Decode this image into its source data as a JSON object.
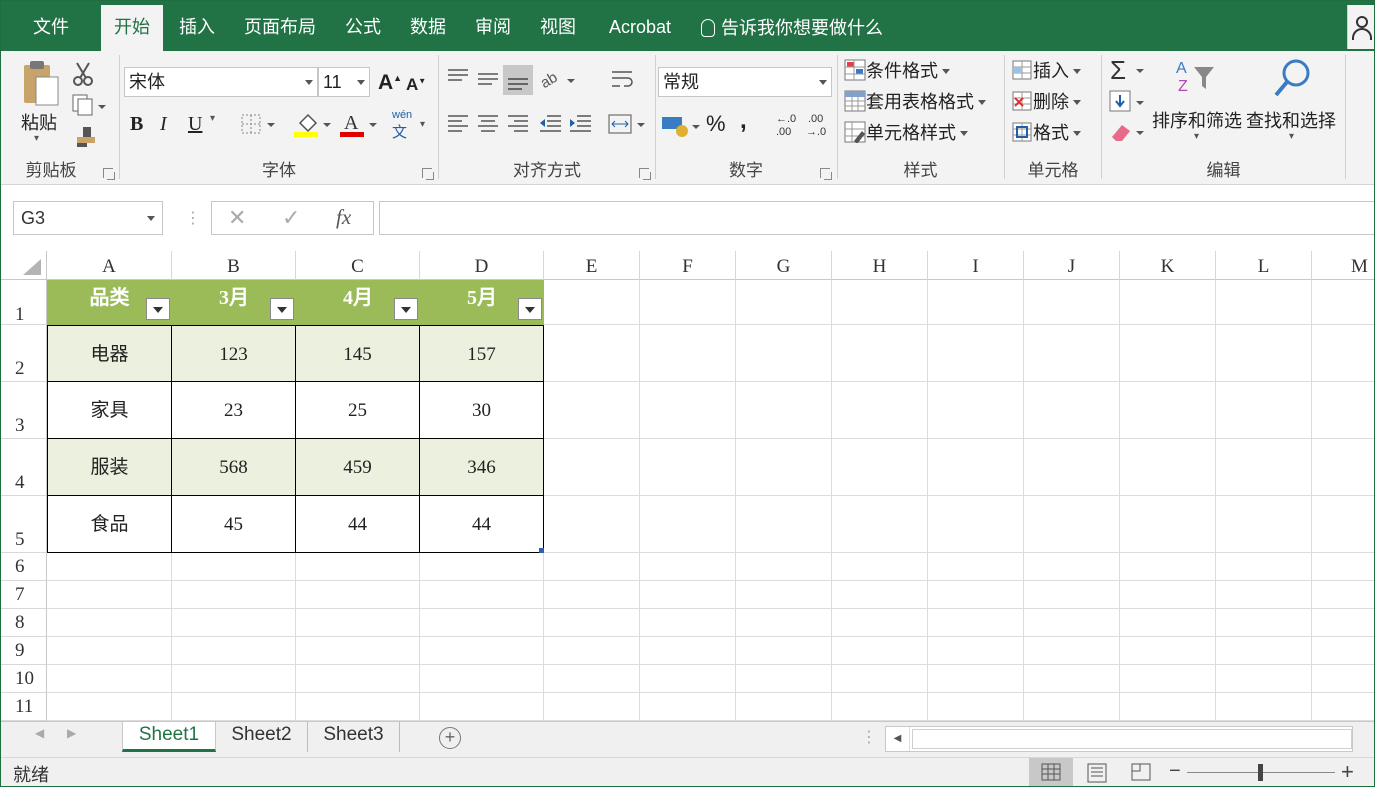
{
  "tabs": [
    "文件",
    "开始",
    "插入",
    "页面布局",
    "公式",
    "数据",
    "审阅",
    "视图",
    "Acrobat"
  ],
  "active_tab": "开始",
  "tell_me": "告诉我你想要做什么",
  "ribbon": {
    "clipboard": {
      "paste": "粘贴",
      "label": "剪贴板"
    },
    "font": {
      "name": "宋体",
      "size": "11",
      "label": "字体",
      "bold": "B",
      "italic": "I",
      "underline": "U",
      "phonetic_top": "wén",
      "phonetic_bottom": "文"
    },
    "alignment": {
      "label": "对齐方式"
    },
    "number": {
      "format": "常规",
      "label": "数字",
      "percent": "%",
      "comma": ","
    },
    "styles": {
      "conditional": "条件格式",
      "table": "套用表格格式",
      "cell": "单元格样式",
      "label": "样式"
    },
    "cells": {
      "insert": "插入",
      "delete": "删除",
      "format": "格式",
      "label": "单元格"
    },
    "editing": {
      "sort": "排序和筛选",
      "find": "查找和选择",
      "label": "编辑"
    }
  },
  "formula_bar": {
    "name_box": "G3",
    "value": ""
  },
  "columns": [
    "A",
    "B",
    "C",
    "D",
    "E",
    "F",
    "G",
    "H",
    "I",
    "J",
    "K",
    "L",
    "M"
  ],
  "rows": [
    "1",
    "2",
    "3",
    "4",
    "5",
    "6",
    "7",
    "8",
    "9",
    "10",
    "11"
  ],
  "table": {
    "headers": [
      "品类",
      "3月",
      "4月",
      "5月"
    ],
    "rows": [
      [
        "电器",
        "123",
        "145",
        "157"
      ],
      [
        "家具",
        "23",
        "25",
        "30"
      ],
      [
        "服装",
        "568",
        "459",
        "346"
      ],
      [
        "食品",
        "45",
        "44",
        "44"
      ]
    ]
  },
  "sheets": [
    "Sheet1",
    "Sheet2",
    "Sheet3"
  ],
  "active_sheet": "Sheet1",
  "status": "就绪",
  "colors": {
    "brand": "#217346",
    "header_fill": "#9BBB59",
    "band_fill": "#EBF1DE"
  }
}
